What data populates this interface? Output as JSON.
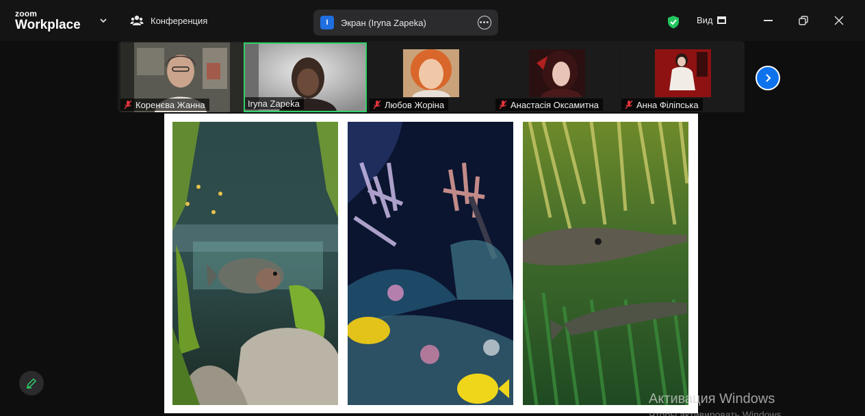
{
  "app": {
    "logo_top": "zoom",
    "logo_bottom": "Workplace",
    "meeting_label": "Конференция"
  },
  "share": {
    "badge": "I",
    "label": "Экран (Iryna Zapeka)"
  },
  "toolbar": {
    "view_label": "Вид"
  },
  "participants": [
    {
      "name": "Коренєва Жанна",
      "muted": true,
      "active": false
    },
    {
      "name": "Iryna Zapeka",
      "muted": false,
      "active": true
    },
    {
      "name": "Любов Жоріна",
      "muted": true,
      "active": false
    },
    {
      "name": "Анастасія Оксамитна",
      "muted": true,
      "active": false
    },
    {
      "name": "Анна Філіпська",
      "muted": true,
      "active": false
    }
  ],
  "colors": {
    "accent": "#0e72ed",
    "active_speaker": "#2fd26a",
    "muted": "#e0343b"
  },
  "watermark": {
    "title": "Активация Windows",
    "subtitle": "Чтобы активировать Windows"
  }
}
